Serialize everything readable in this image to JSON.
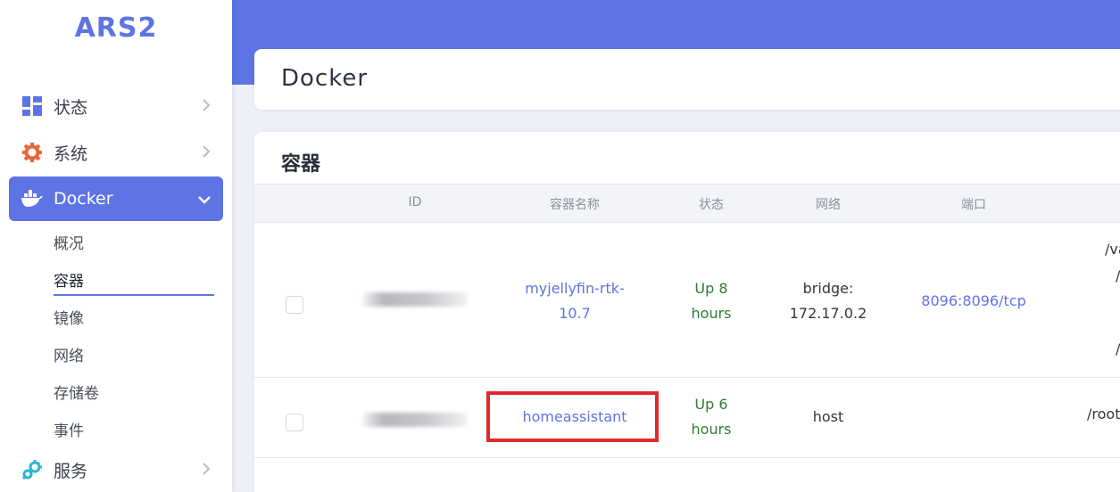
{
  "app": {
    "logo": "ARS2"
  },
  "sidebar": {
    "items": [
      {
        "label": "状态",
        "icon": "dashboard-icon"
      },
      {
        "label": "系统",
        "icon": "gear-icon"
      },
      {
        "label": "Docker",
        "icon": "docker-whale-icon",
        "active": true
      },
      {
        "label": "服务",
        "icon": "services-gears-icon"
      }
    ],
    "docker_subitems": [
      {
        "label": "概况"
      },
      {
        "label": "容器",
        "active": true
      },
      {
        "label": "镜像"
      },
      {
        "label": "网络"
      },
      {
        "label": "存储卷"
      },
      {
        "label": "事件"
      }
    ]
  },
  "header": {
    "title": "Docker"
  },
  "containers": {
    "title": "容器",
    "columns": [
      "ID",
      "容器名称",
      "状态",
      "网络",
      "端口"
    ],
    "rows": [
      {
        "name_line1": "myjellyfin-rtk-",
        "name_line2": "10.7",
        "status_line1": "Up 8",
        "status_line2": "hours",
        "network_line1": "bridge:",
        "network_line2": "172.17.0.2",
        "ports": "8096:8096/tcp",
        "volume_fragments": [
          "/va",
          "/",
          "/"
        ]
      },
      {
        "name_line1": "homeassistant",
        "status_line1": "Up 6",
        "status_line2": "hours",
        "network_line1": "host",
        "ports": "",
        "volume_fragments": [
          "/root"
        ]
      }
    ]
  },
  "colors": {
    "accent": "#5e74e4",
    "status_up": "#2e7d32",
    "highlight": "#e02a2a"
  }
}
